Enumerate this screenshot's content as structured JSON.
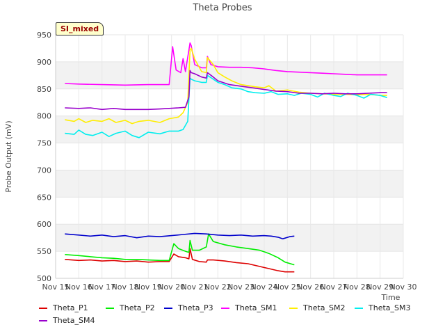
{
  "chart_data": {
    "type": "line",
    "title": "Theta Probes",
    "xlabel": "Time",
    "ylabel": "Probe Output (mV)",
    "ylim": [
      500,
      950
    ],
    "yticks": [
      500,
      550,
      600,
      650,
      700,
      750,
      800,
      850,
      900,
      950
    ],
    "xlim": [
      15,
      30
    ],
    "xticks": [
      {
        "x": 15,
        "label": "Nov 15"
      },
      {
        "x": 16,
        "label": "Nov 16"
      },
      {
        "x": 17,
        "label": "Nov 17"
      },
      {
        "x": 18,
        "label": "Nov 18"
      },
      {
        "x": 19,
        "label": "Nov 19"
      },
      {
        "x": 20,
        "label": "Nov 20"
      },
      {
        "x": 21,
        "label": "Nov 21"
      },
      {
        "x": 22,
        "label": "Nov 22"
      },
      {
        "x": 23,
        "label": "Nov 23"
      },
      {
        "x": 24,
        "label": "Nov 24"
      },
      {
        "x": 25,
        "label": "Nov 25"
      },
      {
        "x": 26,
        "label": "Nov 26"
      },
      {
        "x": 27,
        "label": "Nov 27"
      },
      {
        "x": 28,
        "label": "Nov 28"
      },
      {
        "x": 29,
        "label": "Nov 29"
      },
      {
        "x": 30,
        "label": "Nov 30"
      }
    ],
    "grid": true,
    "legend_position": "bottom",
    "series": [
      {
        "name": "Theta_P1",
        "color": "#dd0000",
        "x": [
          15.4,
          16,
          16.5,
          17,
          17.5,
          18,
          18.5,
          19,
          19.5,
          19.9,
          20.1,
          20.3,
          20.6,
          20.75,
          20.8,
          20.9,
          21.2,
          21.5,
          21.55,
          21.8,
          22.3,
          22.8,
          23.3,
          23.8,
          24.2,
          24.6,
          24.9,
          25.3
        ],
        "y": [
          535,
          533,
          534,
          532,
          533,
          531,
          532,
          530,
          531,
          531,
          545,
          540,
          538,
          536,
          555,
          535,
          531,
          530,
          534,
          534,
          532,
          529,
          527,
          522,
          518,
          514,
          512,
          512
        ]
      },
      {
        "name": "Theta_P2",
        "color": "#00ee00",
        "x": [
          15.4,
          16,
          16.5,
          17,
          17.5,
          18,
          18.5,
          19,
          19.5,
          19.9,
          20.1,
          20.3,
          20.6,
          20.75,
          20.8,
          20.9,
          21.2,
          21.5,
          21.6,
          21.8,
          22.3,
          22.8,
          23.3,
          23.8,
          24.2,
          24.6,
          24.9,
          25.3
        ],
        "y": [
          544,
          542,
          540,
          538,
          537,
          535,
          535,
          534,
          533,
          533,
          564,
          555,
          550,
          548,
          570,
          552,
          552,
          558,
          582,
          568,
          562,
          558,
          555,
          552,
          546,
          538,
          530,
          525
        ]
      },
      {
        "name": "Theta_P3",
        "color": "#0000cc",
        "x": [
          15.4,
          16,
          16.5,
          17,
          17.5,
          18,
          18.5,
          19,
          19.5,
          20,
          20.5,
          21,
          21.5,
          22,
          22.5,
          23,
          23.5,
          24,
          24.3,
          24.6,
          24.8,
          25.1,
          25.3
        ],
        "y": [
          582,
          580,
          578,
          580,
          577,
          579,
          575,
          578,
          577,
          579,
          581,
          583,
          582,
          580,
          579,
          580,
          578,
          579,
          578,
          576,
          573,
          577,
          578
        ]
      },
      {
        "name": "Theta_SM1",
        "color": "#ff00ff",
        "x": [
          15.4,
          16,
          17,
          18,
          19,
          19.9,
          20.05,
          20.2,
          20.4,
          20.5,
          20.6,
          20.8,
          20.85,
          21,
          21.3,
          21.5,
          21.55,
          21.7,
          22,
          22.5,
          23,
          23.5,
          24,
          24.5,
          25,
          25.5,
          26,
          26.5,
          27,
          27.5,
          28,
          28.5,
          29,
          29.3
        ],
        "y": [
          860,
          859,
          858,
          857,
          858,
          858,
          928,
          885,
          880,
          906,
          882,
          935,
          930,
          895,
          889,
          889,
          910,
          895,
          891,
          890,
          890,
          889,
          887,
          884,
          882,
          881,
          880,
          879,
          878,
          877,
          876,
          876,
          876,
          876
        ]
      },
      {
        "name": "Theta_SM2",
        "color": "#ffee00",
        "x": [
          15.4,
          15.8,
          16,
          16.3,
          16.6,
          17,
          17.3,
          17.6,
          18,
          18.3,
          18.6,
          19,
          19.5,
          19.9,
          20.3,
          20.5,
          20.7,
          20.8,
          20.85,
          21,
          21.3,
          21.5,
          21.55,
          21.8,
          22,
          22.3,
          22.6,
          23,
          23.3,
          23.6,
          24,
          24.2,
          24.5,
          25,
          25.5,
          26,
          26.5,
          27,
          27.5,
          28,
          28.5,
          29,
          29.3
        ],
        "y": [
          793,
          790,
          795,
          788,
          792,
          790,
          795,
          788,
          792,
          786,
          790,
          792,
          788,
          795,
          798,
          806,
          825,
          922,
          925,
          905,
          882,
          880,
          908,
          895,
          880,
          872,
          865,
          858,
          856,
          854,
          852,
          856,
          846,
          848,
          844,
          842,
          841,
          840,
          840,
          839,
          840,
          838,
          838
        ]
      },
      {
        "name": "Theta_SM3",
        "color": "#00eeee",
        "x": [
          15.4,
          15.8,
          16,
          16.3,
          16.6,
          17,
          17.3,
          17.6,
          18,
          18.3,
          18.6,
          19,
          19.5,
          19.9,
          20.3,
          20.5,
          20.7,
          20.8,
          20.85,
          21,
          21.3,
          21.5,
          21.55,
          21.8,
          22,
          22.3,
          22.6,
          23,
          23.3,
          23.6,
          24,
          24.3,
          24.6,
          25,
          25.3,
          25.6,
          26,
          26.3,
          26.6,
          27,
          27.3,
          27.6,
          28,
          28.3,
          28.6,
          29,
          29.3
        ],
        "y": [
          768,
          766,
          774,
          766,
          764,
          770,
          762,
          768,
          772,
          764,
          760,
          770,
          767,
          772,
          772,
          775,
          790,
          870,
          868,
          865,
          862,
          862,
          875,
          868,
          862,
          858,
          852,
          850,
          845,
          843,
          842,
          845,
          840,
          841,
          838,
          842,
          840,
          835,
          842,
          838,
          836,
          842,
          838,
          833,
          840,
          838,
          834
        ]
      },
      {
        "name": "Theta_SM4",
        "color": "#9900cc",
        "x": [
          15.4,
          16,
          16.5,
          17,
          17.5,
          18,
          18.5,
          19,
          19.5,
          19.9,
          20.3,
          20.6,
          20.75,
          20.8,
          20.85,
          21,
          21.3,
          21.5,
          21.55,
          21.8,
          22,
          22.5,
          23,
          23.5,
          24,
          24.5,
          25,
          25.5,
          26,
          26.5,
          27,
          27.5,
          28,
          28.5,
          29,
          29.3
        ],
        "y": [
          815,
          814,
          815,
          812,
          814,
          812,
          812,
          812,
          813,
          814,
          815,
          816,
          835,
          884,
          880,
          878,
          872,
          870,
          880,
          872,
          865,
          858,
          855,
          852,
          849,
          846,
          845,
          842,
          842,
          841,
          842,
          841,
          841,
          842,
          843,
          843
        ]
      }
    ]
  },
  "badge": {
    "label": "SI_mixed"
  }
}
